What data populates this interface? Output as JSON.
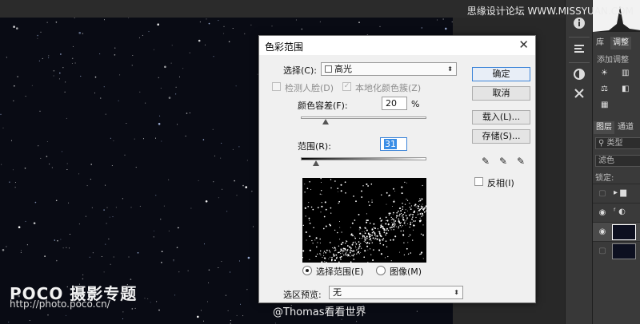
{
  "dialog": {
    "title": "色彩范围",
    "select_label": "选择(C):",
    "select_value": "高光",
    "detect_faces_label": "检测人脸(D)",
    "localized_label": "本地化颜色簇(Z)",
    "fuzziness_label": "颜色容差(F):",
    "fuzziness_value": "20",
    "fuzziness_unit": "%",
    "fuzziness_level": 0.2,
    "range_label": "范围(R):",
    "range_value": "31",
    "range_level": 0.12,
    "radio_selection_label": "选择范围(E)",
    "radio_image_label": "图像(M)",
    "preview_label": "选区预览:",
    "preview_value": "无",
    "invert_label": "反相(I)",
    "buttons": {
      "ok": "确定",
      "cancel": "取消",
      "load": "载入(L)...",
      "save": "存储(S)..."
    }
  },
  "panel": {
    "tab_library": "库",
    "tab_adjust": "调整",
    "add_adjustment": "添加调整",
    "tab_layers": "图层",
    "tab_channels": "通道",
    "filter_kind": "类型",
    "blend_mode": "滤色",
    "lock_label": "锁定:"
  },
  "icons": {
    "info": "info-icon",
    "properties": "properties-icon",
    "adjust": "adjust-icon",
    "tools": "tools-icon"
  },
  "watermarks": {
    "logo": "POCO 摄影专题",
    "url": "http://photo.poco.cn/",
    "top_right": "思缘设计论坛 WWW.MISSYUAN.COM",
    "author": "@Thomas看看世界"
  },
  "colors": {
    "accent": "#3c84d8",
    "canvas": "#090b14",
    "panel": "#3a3a3a"
  }
}
